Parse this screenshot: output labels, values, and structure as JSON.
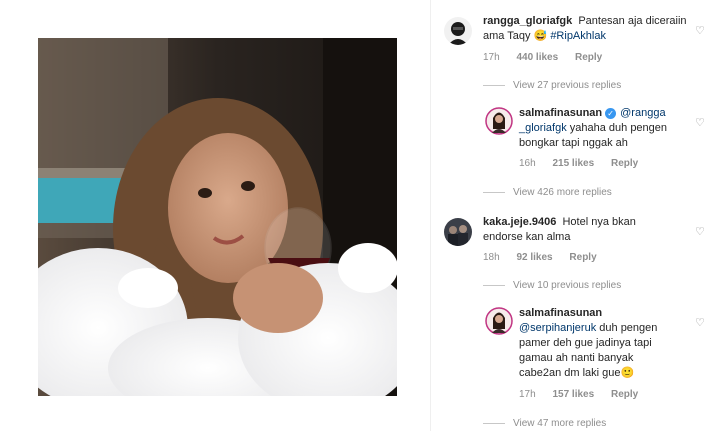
{
  "comments": [
    {
      "username": "rangga_gloriafgk",
      "text": "Pantesan aja diceraiin ama Taqy 😅",
      "hashtag": "#RipAkhlak",
      "time": "17h",
      "likes": "440 likes",
      "reply_label": "Reply"
    },
    {
      "view_more": "View 27 previous replies"
    },
    {
      "username": "salmafinasunan",
      "verified": true,
      "mention": "@rangga_gloriafgk",
      "mention_line1": "@rangga",
      "mention_line2": "_gloriafgk",
      "text": "yahaha duh pengen bongkar tapi nggak ah",
      "text_line1": "yahaha duh pengen",
      "text_line2": "bongkar tapi nggak ah",
      "time": "16h",
      "likes": "215 likes",
      "reply_label": "Reply"
    },
    {
      "view_more": "View 426 more replies"
    },
    {
      "username": "kaka.jeje.9406",
      "text": "Hotel nya bkan endorse kan alma",
      "text_line1": "Hotel nya bkan",
      "text_line2": "endorse kan alma",
      "time": "18h",
      "likes": "92 likes",
      "reply_label": "Reply"
    },
    {
      "view_more": "View 10 previous replies"
    },
    {
      "username": "salmafinasunan",
      "mention": "@serpihanjeruk",
      "text_line1": "duh pengen",
      "text_line2": "pamer deh gue jadinya tapi",
      "text_line3": "gamau ah nanti banyak",
      "text_line4": "cabe2an dm laki gue🙂",
      "time": "17h",
      "likes": "157 likes",
      "reply_label": "Reply"
    },
    {
      "view_more": "View 47 more replies"
    }
  ],
  "icons": {
    "heart": "heart-outline-icon",
    "verified": "verified-badge-icon"
  },
  "colors": {
    "username": "#262626",
    "mention": "#00376b",
    "meta": "#8e8e8e",
    "verified": "#3897f0"
  }
}
